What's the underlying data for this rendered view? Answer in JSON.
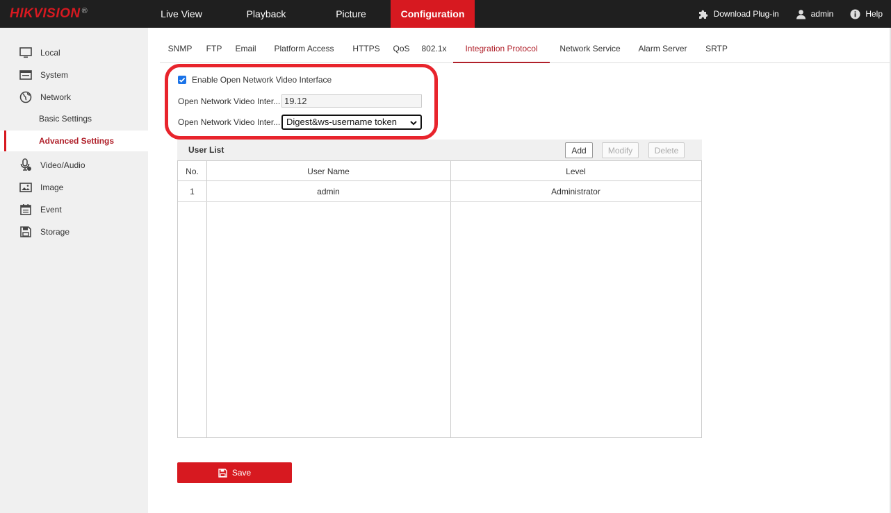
{
  "brand": {
    "name": "HIKVISION",
    "registered": "®"
  },
  "nav": [
    {
      "label": "Live View",
      "active": false
    },
    {
      "label": "Playback",
      "active": false
    },
    {
      "label": "Picture",
      "active": false
    },
    {
      "label": "Configuration",
      "active": true
    }
  ],
  "top_right": {
    "download": "Download Plug-in",
    "user": "admin",
    "help": "Help"
  },
  "sidebar": {
    "items": [
      {
        "label": "Local",
        "icon": "monitor-icon"
      },
      {
        "label": "System",
        "icon": "system-window-icon"
      },
      {
        "label": "Network",
        "icon": "globe-icon"
      },
      {
        "label": "Basic Settings",
        "sub": true
      },
      {
        "label": "Advanced Settings",
        "sub": true,
        "active": true
      },
      {
        "label": "Video/Audio",
        "icon": "microphone-icon"
      },
      {
        "label": "Image",
        "icon": "image-icon"
      },
      {
        "label": "Event",
        "icon": "calendar-icon"
      },
      {
        "label": "Storage",
        "icon": "save-disk-icon"
      }
    ]
  },
  "tabs": [
    {
      "label": "SNMP"
    },
    {
      "label": "FTP"
    },
    {
      "label": "Email"
    },
    {
      "label": "Platform Access"
    },
    {
      "label": "HTTPS"
    },
    {
      "label": "QoS"
    },
    {
      "label": "802.1x"
    },
    {
      "label": "Integration Protocol",
      "active": true
    },
    {
      "label": "Network Service"
    },
    {
      "label": "Alarm Server"
    },
    {
      "label": "SRTP"
    }
  ],
  "onvif": {
    "enable_label": "Enable Open Network Video Interface",
    "enabled": true,
    "version_label": "Open Network Video Inter...",
    "version_value": "19.12",
    "auth_label": "Open Network Video Inter...",
    "auth_value": "Digest&ws-username token"
  },
  "user_list": {
    "title": "User List",
    "add": "Add",
    "modify": "Modify",
    "delete": "Delete",
    "columns": [
      "No.",
      "User Name",
      "Level"
    ],
    "rows": [
      {
        "no": "1",
        "user": "admin",
        "level": "Administrator"
      }
    ]
  },
  "save_label": "Save",
  "colors": {
    "accent": "#d71920",
    "topbar": "#1f1f1f",
    "sidebar": "#f0f0f0",
    "highlight": "#e8242c"
  }
}
